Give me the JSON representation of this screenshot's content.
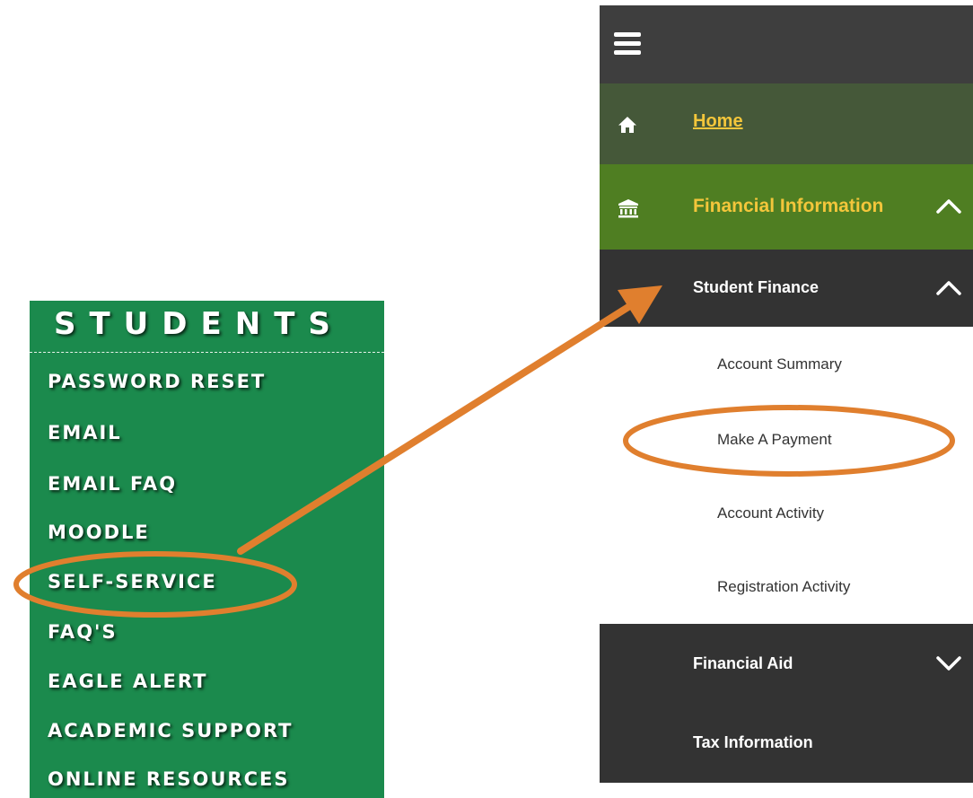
{
  "students_panel": {
    "title": "STUDENTS",
    "links": [
      "PASSWORD RESET",
      "EMAIL",
      "EMAIL FAQ",
      "MOODLE",
      "SELF-SERVICE",
      "FAQ'S",
      "EAGLE ALERT",
      "ACADEMIC SUPPORT",
      "ONLINE RESOURCES"
    ]
  },
  "nav": {
    "menu_icon": "hamburger-menu-icon",
    "home": {
      "label": "Home",
      "icon": "home-icon"
    },
    "financial_information": {
      "label": "Financial Information",
      "icon": "bank-icon",
      "expanded": true
    },
    "student_finance": {
      "label": "Student Finance",
      "expanded": true,
      "items": [
        "Account Summary",
        "Make A Payment",
        "Account Activity",
        "Registration Activity"
      ]
    },
    "financial_aid": {
      "label": "Financial Aid",
      "expanded": false
    },
    "tax_information": {
      "label": "Tax Information"
    }
  },
  "annotations": {
    "color": "#e07f2e",
    "arrow_from": "SELF-SERVICE",
    "arrow_to": "Student Finance",
    "highlighted": [
      "SELF-SERVICE",
      "Make A Payment"
    ]
  },
  "colors": {
    "students_green": "#1b8a4d",
    "topbar": "#3e3e3e",
    "home_bg": "#455839",
    "financial_bg": "#4f7e22",
    "dark_bg": "#333333",
    "gold_text": "#f3c63b",
    "annotation_orange": "#e07f2e"
  }
}
